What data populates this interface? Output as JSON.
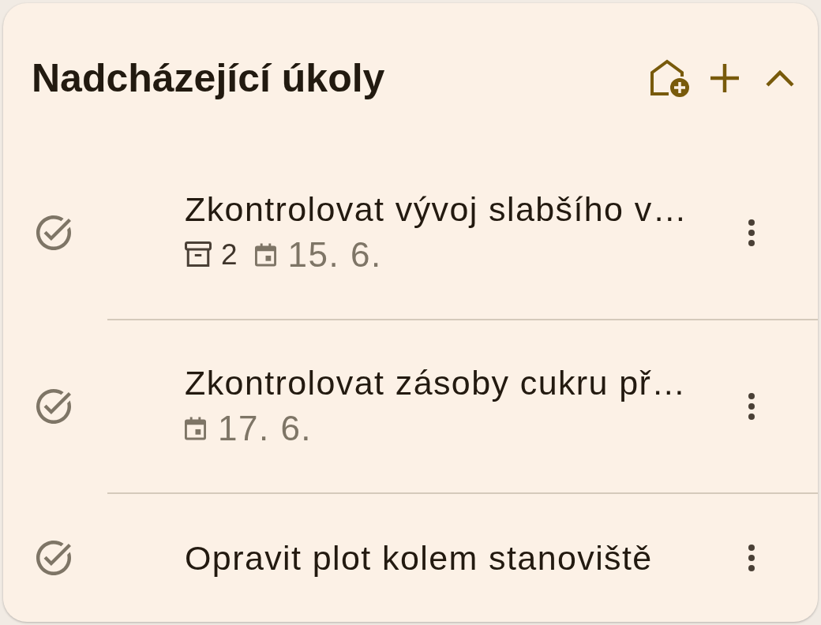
{
  "card": {
    "title": "Nadcházející úkoly",
    "expanded": true
  },
  "tasks": [
    {
      "title": "Zkontrolovat vývoj slabšího v…",
      "subtask_count": "2",
      "due": "15. 6."
    },
    {
      "title": "Zkontrolovat zásoby cukru př…",
      "due": "17. 6."
    },
    {
      "title": "Opravit plot kolem stanoviště"
    }
  ]
}
